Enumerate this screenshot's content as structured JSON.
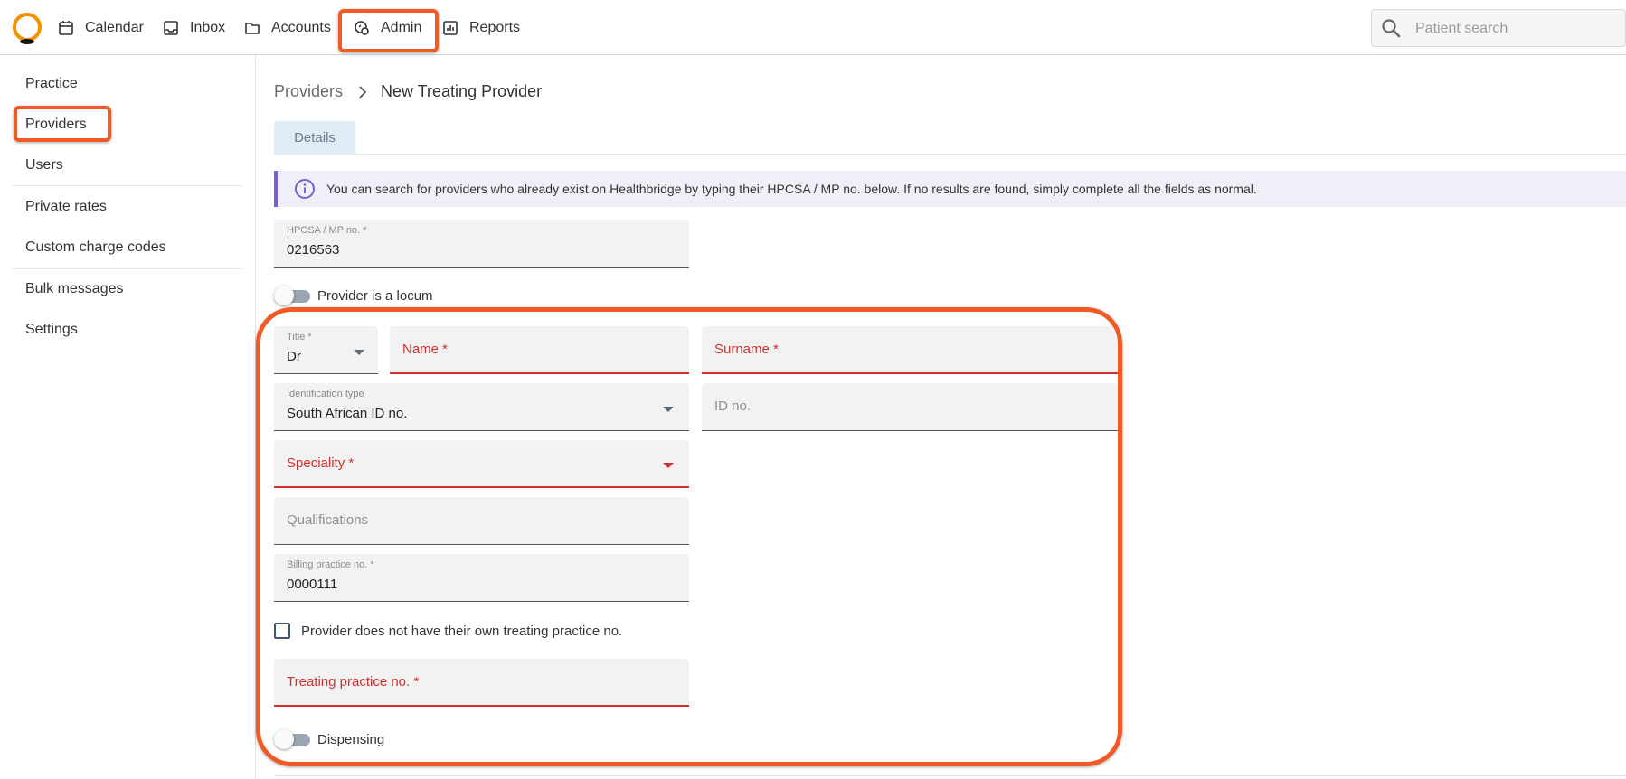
{
  "nav": {
    "items": [
      {
        "label": "Calendar",
        "icon": "calendar-icon"
      },
      {
        "label": "Inbox",
        "icon": "inbox-icon"
      },
      {
        "label": "Accounts",
        "icon": "folder-icon"
      },
      {
        "label": "Admin",
        "icon": "admin-icon"
      },
      {
        "label": "Reports",
        "icon": "reports-icon"
      }
    ],
    "search_placeholder": "Patient search",
    "highlight_color": "#f15a24"
  },
  "sidebar": {
    "items": [
      {
        "label": "Practice"
      },
      {
        "label": "Providers"
      },
      {
        "label": "Users"
      },
      {
        "label": "Private rates"
      },
      {
        "label": "Custom charge codes"
      },
      {
        "label": "Bulk messages"
      },
      {
        "label": "Settings"
      }
    ]
  },
  "main": {
    "breadcrumb": {
      "parent": "Providers",
      "current": "New Treating Provider"
    },
    "tab": "Details",
    "info": "You can search for providers who already exist on Healthbridge by typing their HPCSA / MP no. below. If no results are found, simply complete all the fields as normal."
  },
  "form": {
    "hpcsa": {
      "label": "HPCSA / MP no. *",
      "value": "0216563"
    },
    "locum_label": "Provider is a locum",
    "title": {
      "label": "Title *",
      "value": "Dr"
    },
    "name_placeholder": "Name *",
    "surname_placeholder": "Surname *",
    "id_type": {
      "label": "Identification type",
      "value": "South African ID no."
    },
    "id_no_placeholder": "ID no.",
    "speciality_placeholder": "Speciality *",
    "qualifications_placeholder": "Qualifications",
    "billing": {
      "label": "Billing practice no. *",
      "value": "0000111"
    },
    "no_treating_label": "Provider does not have their own treating practice no.",
    "treating_placeholder": "Treating practice no. *",
    "dispensing_label": "Dispensing",
    "error_color": "#d32f2f"
  }
}
